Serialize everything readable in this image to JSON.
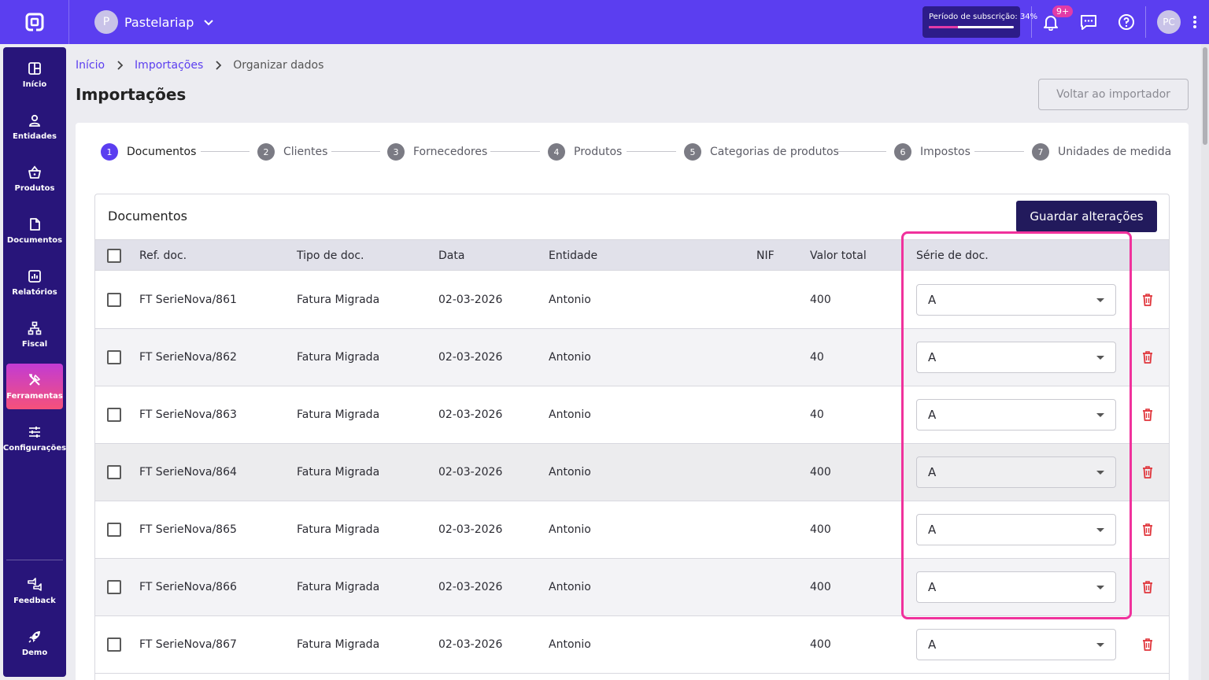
{
  "topbar": {
    "company_initial": "P",
    "company_name": "Pastelariap",
    "subscription_label": "Período de subscrição: 34%",
    "subscription_progress": 0.34,
    "notification_badge": "9+",
    "user_initials": "PC"
  },
  "sidebar": {
    "items": [
      {
        "label": "Início",
        "icon": "dashboard-icon"
      },
      {
        "label": "Entidades",
        "icon": "person-icon"
      },
      {
        "label": "Produtos",
        "icon": "basket-icon"
      },
      {
        "label": "Documentos",
        "icon": "document-icon"
      },
      {
        "label": "Relatórios",
        "icon": "report-icon"
      },
      {
        "label": "Fiscal",
        "icon": "hierarchy-icon"
      },
      {
        "label": "Ferramentas",
        "icon": "tools-icon",
        "active": true
      },
      {
        "label": "Configurações",
        "icon": "sliders-icon"
      }
    ],
    "bottom": [
      {
        "label": "Feedback",
        "icon": "feedback-icon"
      },
      {
        "label": "Demo",
        "icon": "rocket-icon"
      }
    ]
  },
  "breadcrumb": {
    "home": "Início",
    "imports": "Importações",
    "current": "Organizar dados"
  },
  "page": {
    "title": "Importações",
    "back_button": "Voltar ao importador"
  },
  "steps": [
    {
      "num": "1",
      "label": "Documentos"
    },
    {
      "num": "2",
      "label": "Clientes"
    },
    {
      "num": "3",
      "label": "Fornecedores"
    },
    {
      "num": "4",
      "label": "Produtos"
    },
    {
      "num": "5",
      "label": "Categorias de produtos"
    },
    {
      "num": "6",
      "label": "Impostos"
    },
    {
      "num": "7",
      "label": "Unidades de medida"
    }
  ],
  "table": {
    "title": "Documentos",
    "save_button": "Guardar alterações",
    "columns": {
      "ref": "Ref. doc.",
      "type": "Tipo de doc.",
      "date": "Data",
      "entity": "Entidade",
      "nif": "NIF",
      "total": "Valor total",
      "series": "Série de doc."
    },
    "rows": [
      {
        "ref": "FT SerieNova/861",
        "type": "Fatura Migrada",
        "date": "02-03-2026",
        "entity": "Antonio",
        "nif": "",
        "total": "400",
        "series": "A"
      },
      {
        "ref": "FT SerieNova/862",
        "type": "Fatura Migrada",
        "date": "02-03-2026",
        "entity": "Antonio",
        "nif": "",
        "total": "40",
        "series": "A"
      },
      {
        "ref": "FT SerieNova/863",
        "type": "Fatura Migrada",
        "date": "02-03-2026",
        "entity": "Antonio",
        "nif": "",
        "total": "40",
        "series": "A"
      },
      {
        "ref": "FT SerieNova/864",
        "type": "Fatura Migrada",
        "date": "02-03-2026",
        "entity": "Antonio",
        "nif": "",
        "total": "400",
        "series": "A"
      },
      {
        "ref": "FT SerieNova/865",
        "type": "Fatura Migrada",
        "date": "02-03-2026",
        "entity": "Antonio",
        "nif": "",
        "total": "400",
        "series": "A"
      },
      {
        "ref": "FT SerieNova/866",
        "type": "Fatura Migrada",
        "date": "02-03-2026",
        "entity": "Antonio",
        "nif": "",
        "total": "400",
        "series": "A"
      },
      {
        "ref": "FT SerieNova/867",
        "type": "Fatura Migrada",
        "date": "02-03-2026",
        "entity": "Antonio",
        "nif": "",
        "total": "400",
        "series": "A"
      }
    ]
  },
  "colors": {
    "brand": "#5b3ef0",
    "sidebar": "#28157a",
    "highlight": "#f0329c",
    "delete": "#e0363c"
  }
}
